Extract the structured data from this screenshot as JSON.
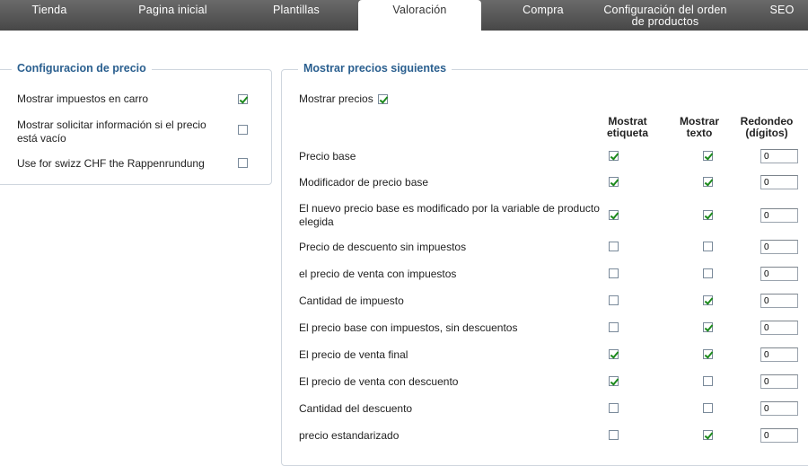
{
  "tabs": [
    {
      "label": "Tienda"
    },
    {
      "label": "Pagina inicial"
    },
    {
      "label": "Plantillas"
    },
    {
      "label": "Valoración"
    },
    {
      "label": "Compra"
    },
    {
      "label": "Configuración del orden de productos"
    },
    {
      "label": "SEO"
    }
  ],
  "price_config": {
    "title": "Configuracion de precio",
    "rows": [
      {
        "label": "Mostrar impuestos en carro",
        "checked": true
      },
      {
        "label": "Mostrar solicitar información si el precio está vacío",
        "checked": false
      },
      {
        "label": "Use for swizz CHF the Rappenrundung",
        "checked": false
      }
    ]
  },
  "show_prices": {
    "title": "Mostrar precios siguientes",
    "show_label": "Mostrar precios",
    "show_checked": true,
    "headers": {
      "label": "Mostrat etiqueta",
      "text": "Mostrar texto",
      "round": "Redondeo (dígitos)"
    },
    "rows": [
      {
        "label": "Precio base",
        "show_label": true,
        "show_text": true,
        "round": "0"
      },
      {
        "label": "Modificador de precio base",
        "show_label": true,
        "show_text": true,
        "round": "0"
      },
      {
        "label": "El nuevo precio base es modificado por la variable de producto elegida",
        "show_label": true,
        "show_text": true,
        "round": "0"
      },
      {
        "label": "Precio de descuento sin impuestos",
        "show_label": false,
        "show_text": false,
        "round": "0"
      },
      {
        "label": "el precio de venta con impuestos",
        "show_label": false,
        "show_text": false,
        "round": "0"
      },
      {
        "label": "Cantidad de impuesto",
        "show_label": false,
        "show_text": true,
        "round": "0"
      },
      {
        "label": "El precio base con impuestos, sin descuentos",
        "show_label": false,
        "show_text": true,
        "round": "0"
      },
      {
        "label": "El precio de venta final",
        "show_label": true,
        "show_text": true,
        "round": "0"
      },
      {
        "label": "El precio de venta con descuento",
        "show_label": true,
        "show_text": false,
        "round": "0"
      },
      {
        "label": "Cantidad del descuento",
        "show_label": false,
        "show_text": false,
        "round": "0"
      },
      {
        "label": "precio estandarizado",
        "show_label": false,
        "show_text": true,
        "round": "0"
      }
    ]
  }
}
